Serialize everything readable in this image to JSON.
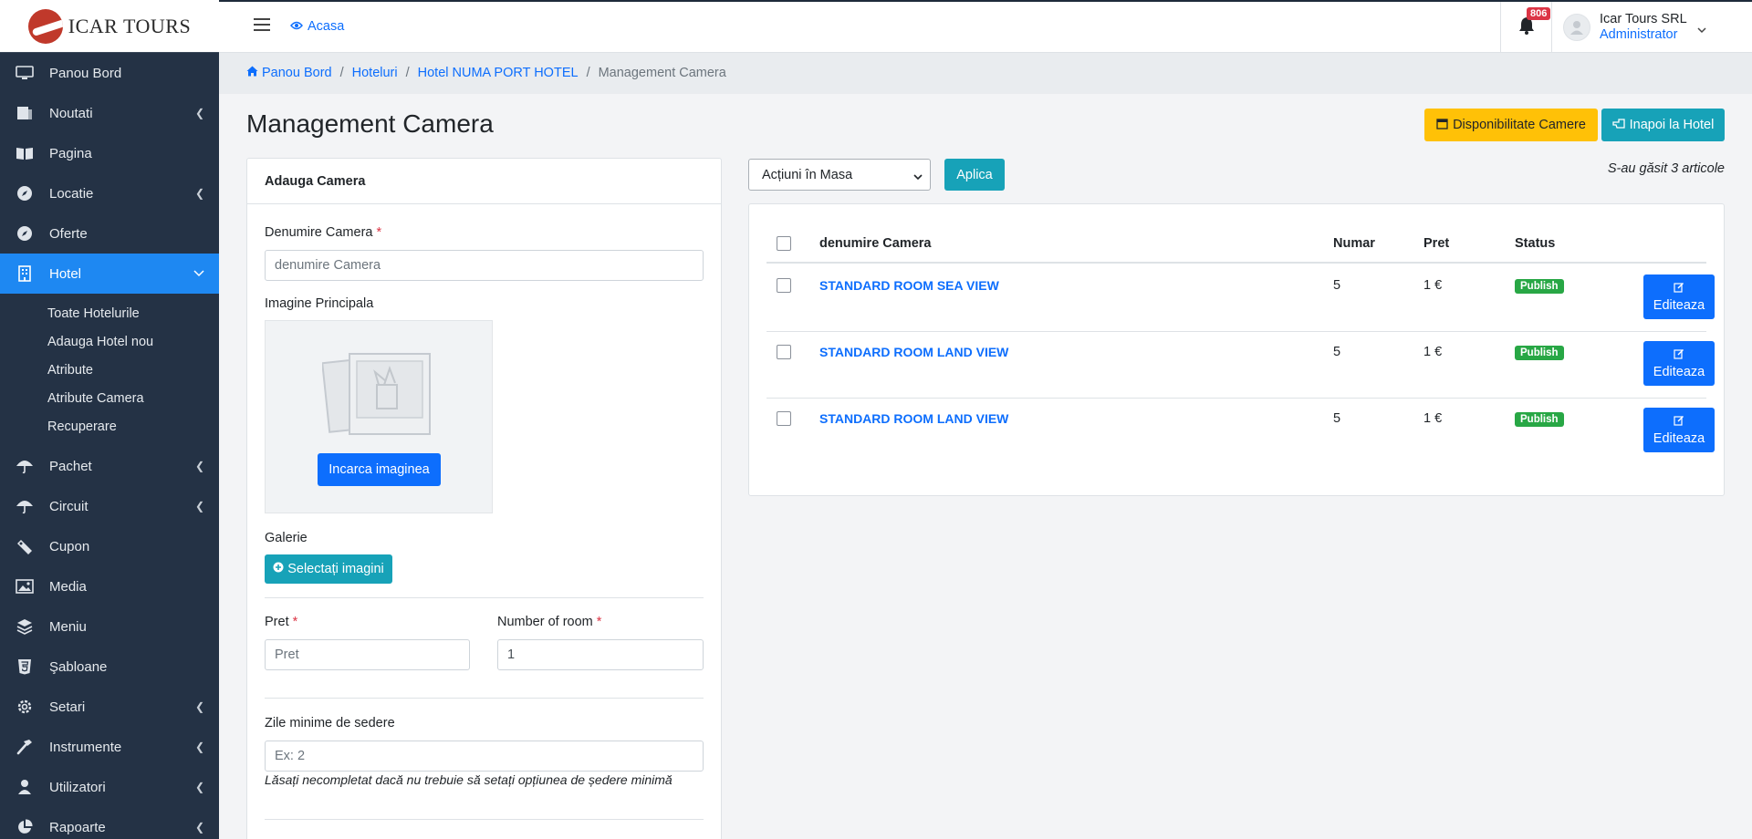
{
  "brand": {
    "name": "ICAR TOURS"
  },
  "sidebar": {
    "items": [
      {
        "label": "Panou Bord",
        "icon": "monitor-icon",
        "has_chevron": false
      },
      {
        "label": "Noutati",
        "icon": "newspaper-icon",
        "has_chevron": true
      },
      {
        "label": "Pagina",
        "icon": "book-icon",
        "has_chevron": false
      },
      {
        "label": "Locatie",
        "icon": "compass-icon",
        "has_chevron": true
      },
      {
        "label": "Oferte",
        "icon": "compass-icon",
        "has_chevron": false
      },
      {
        "label": "Hotel",
        "icon": "building-icon",
        "has_chevron": true,
        "active": true
      },
      {
        "label": "Pachet",
        "icon": "umbrella-icon",
        "has_chevron": true
      },
      {
        "label": "Circuit",
        "icon": "umbrella-icon",
        "has_chevron": true
      },
      {
        "label": "Cupon",
        "icon": "ticket-icon",
        "has_chevron": false
      },
      {
        "label": "Media",
        "icon": "image-icon",
        "has_chevron": false
      },
      {
        "label": "Meniu",
        "icon": "layers-icon",
        "has_chevron": false
      },
      {
        "label": "Şabloane",
        "icon": "html5-icon",
        "has_chevron": false
      },
      {
        "label": "Setari",
        "icon": "gear-icon",
        "has_chevron": true
      },
      {
        "label": "Instrumente",
        "icon": "hammer-icon",
        "has_chevron": true
      },
      {
        "label": "Utilizatori",
        "icon": "user-icon",
        "has_chevron": true
      },
      {
        "label": "Rapoarte",
        "icon": "pie-chart-icon",
        "has_chevron": true
      }
    ],
    "hotel_sub": [
      "Toate Hotelurile",
      "Adauga Hotel nou",
      "Atribute",
      "Atribute Camera",
      "Recuperare"
    ]
  },
  "topbar": {
    "home_label": "Acasa",
    "notif_count": "806",
    "user_name": "Icar Tours SRL",
    "user_role": "Administrator"
  },
  "breadcrumb": {
    "items": [
      "Panou Bord",
      "Hoteluri",
      "Hotel NUMA PORT HOTEL"
    ],
    "current": "Management Camera"
  },
  "page": {
    "title": "Management Camera",
    "btn_availability": "Disponibilitate Camere",
    "btn_back": "Inapoi la Hotel"
  },
  "form": {
    "card_title": "Adauga Camera",
    "name_label": "Denumire Camera",
    "name_placeholder": "denumire Camera",
    "image_label": "Imagine Principala",
    "upload_btn": "Incarca imaginea",
    "gallery_label": "Galerie",
    "gallery_btn": "Selectați imagini",
    "price_label": "Pret",
    "price_placeholder": "Pret",
    "rooms_label": "Number of room",
    "rooms_value": "1",
    "minstay_label": "Zile minime de sedere",
    "minstay_placeholder": "Ex: 2",
    "minstay_help": "Lăsați necompletat dacă nu trebuie să setați opțiunea de ședere minimă"
  },
  "list": {
    "bulk_select": "Acțiuni în Masa",
    "apply_btn": "Aplica",
    "found_text": "S-au găsit 3 articole",
    "headers": {
      "name": "denumire Camera",
      "number": "Numar",
      "price": "Pret",
      "status": "Status"
    },
    "edit_label": "Editeaza",
    "rows": [
      {
        "name": "STANDARD ROOM SEA VIEW",
        "number": "5",
        "price": "1 €",
        "status": "Publish"
      },
      {
        "name": "STANDARD ROOM LAND VIEW",
        "number": "5",
        "price": "1 €",
        "status": "Publish"
      },
      {
        "name": "STANDARD ROOM LAND VIEW",
        "number": "5",
        "price": "1 €",
        "status": "Publish"
      }
    ]
  },
  "colors": {
    "sidebar_bg": "#243245",
    "accent": "#1e88f2",
    "primary": "#0d6efd",
    "info": "#17a2b8",
    "warning": "#ffc107",
    "success": "#28a745",
    "danger": "#dc3545"
  }
}
